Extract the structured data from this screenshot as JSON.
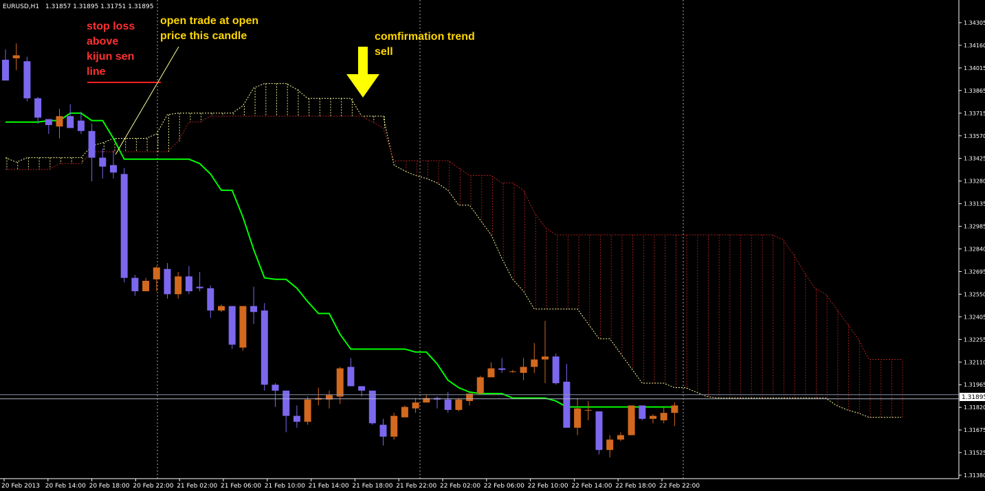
{
  "header": {
    "symbol": "EURUSD,H1",
    "ohlc": "1.31857 1.31895 1.31751 1.31895"
  },
  "colors": {
    "background": "#000000",
    "bull_candle": "#d2691e",
    "bear_candle": "#7b68ee",
    "kijun_sen": "#00ff00",
    "senkou_span_a": "#ffff99",
    "senkou_span_b": "#b22222",
    "axis": "#ffffff",
    "arrow": "#ffff00",
    "stop_loss_text": "#ff3030",
    "trade_text": "#ffd700"
  },
  "annotations": {
    "stop_loss": [
      "stop loss",
      "above",
      "kijun sen",
      "line"
    ],
    "open_trade": [
      "open trade at open",
      "price this candle"
    ],
    "confirmation": [
      "comfirmation trend",
      "sell"
    ]
  },
  "chart_data": {
    "type": "candlestick",
    "title": "EURUSD,H1",
    "ylim": [
      1.3138,
      1.3443
    ],
    "y_ticks": [
      "1.34305",
      "1.34160",
      "1.34015",
      "1.33865",
      "1.33715",
      "1.33570",
      "1.33425",
      "1.33280",
      "1.33135",
      "1.32985",
      "1.32840",
      "1.32695",
      "1.32550",
      "1.32405",
      "1.32255",
      "1.32110",
      "1.31965",
      "1.31820",
      "1.31675",
      "1.31525",
      "1.31380"
    ],
    "current_price": "1.31895",
    "x_labels": [
      "20 Feb 2013",
      "20 Feb 14:00",
      "20 Feb 18:00",
      "20 Feb 22:00",
      "21 Feb 02:00",
      "21 Feb 06:00",
      "21 Feb 10:00",
      "21 Feb 14:00",
      "21 Feb 18:00",
      "21 Feb 22:00",
      "22 Feb 02:00",
      "22 Feb 06:00",
      "22 Feb 10:00",
      "22 Feb 14:00",
      "22 Feb 18:00",
      "22 Feb 22:00"
    ],
    "candles": [
      {
        "o": 1.3418,
        "h": 1.3425,
        "l": 1.3404,
        "c": 1.3404
      },
      {
        "o": 1.3419,
        "h": 1.3429,
        "l": 1.3411,
        "c": 1.3421
      },
      {
        "o": 1.3417,
        "h": 1.342,
        "l": 1.339,
        "c": 1.3392
      },
      {
        "o": 1.3392,
        "h": 1.3393,
        "l": 1.3375,
        "c": 1.3379
      },
      {
        "o": 1.3378,
        "h": 1.3378,
        "l": 1.3368,
        "c": 1.3374
      },
      {
        "o": 1.3373,
        "h": 1.3385,
        "l": 1.3365,
        "c": 1.338
      },
      {
        "o": 1.338,
        "h": 1.3388,
        "l": 1.3373,
        "c": 1.3372
      },
      {
        "o": 1.3377,
        "h": 1.3383,
        "l": 1.3368,
        "c": 1.337
      },
      {
        "o": 1.337,
        "h": 1.3375,
        "l": 1.3336,
        "c": 1.3352
      },
      {
        "o": 1.3352,
        "h": 1.3358,
        "l": 1.3338,
        "c": 1.3346
      },
      {
        "o": 1.3347,
        "h": 1.3357,
        "l": 1.3338,
        "c": 1.3342
      },
      {
        "o": 1.3341,
        "h": 1.3345,
        "l": 1.3268,
        "c": 1.3271
      },
      {
        "o": 1.3271,
        "h": 1.3273,
        "l": 1.3259,
        "c": 1.3262
      },
      {
        "o": 1.3262,
        "h": 1.3271,
        "l": 1.3262,
        "c": 1.3269
      },
      {
        "o": 1.327,
        "h": 1.3279,
        "l": 1.3262,
        "c": 1.3278
      },
      {
        "o": 1.3277,
        "h": 1.3281,
        "l": 1.3257,
        "c": 1.326
      },
      {
        "o": 1.326,
        "h": 1.3275,
        "l": 1.3257,
        "c": 1.3272
      },
      {
        "o": 1.3272,
        "h": 1.3279,
        "l": 1.326,
        "c": 1.3262
      },
      {
        "o": 1.3265,
        "h": 1.3275,
        "l": 1.3262,
        "c": 1.3264
      },
      {
        "o": 1.3264,
        "h": 1.3266,
        "l": 1.3244,
        "c": 1.3249
      },
      {
        "o": 1.3249,
        "h": 1.3253,
        "l": 1.3248,
        "c": 1.3252
      },
      {
        "o": 1.3252,
        "h": 1.3252,
        "l": 1.3223,
        "c": 1.3226
      },
      {
        "o": 1.3224,
        "h": 1.3252,
        "l": 1.3222,
        "c": 1.3252
      },
      {
        "o": 1.3252,
        "h": 1.3265,
        "l": 1.324,
        "c": 1.3248
      },
      {
        "o": 1.3249,
        "h": 1.3254,
        "l": 1.3195,
        "c": 1.3199
      },
      {
        "o": 1.3199,
        "h": 1.32,
        "l": 1.3184,
        "c": 1.3195
      },
      {
        "o": 1.3195,
        "h": 1.3195,
        "l": 1.3167,
        "c": 1.3178
      },
      {
        "o": 1.3178,
        "h": 1.3185,
        "l": 1.317,
        "c": 1.3174
      },
      {
        "o": 1.3174,
        "h": 1.3191,
        "l": 1.3172,
        "c": 1.3189
      },
      {
        "o": 1.3189,
        "h": 1.3197,
        "l": 1.3185,
        "c": 1.319
      },
      {
        "o": 1.3189,
        "h": 1.3195,
        "l": 1.3183,
        "c": 1.3192
      },
      {
        "o": 1.3191,
        "h": 1.3211,
        "l": 1.3186,
        "c": 1.321
      },
      {
        "o": 1.3211,
        "h": 1.3217,
        "l": 1.3198,
        "c": 1.3198
      },
      {
        "o": 1.3198,
        "h": 1.3198,
        "l": 1.3191,
        "c": 1.3195
      },
      {
        "o": 1.3195,
        "h": 1.3195,
        "l": 1.3172,
        "c": 1.3173
      },
      {
        "o": 1.3172,
        "h": 1.3176,
        "l": 1.3158,
        "c": 1.3164
      },
      {
        "o": 1.3164,
        "h": 1.318,
        "l": 1.3162,
        "c": 1.3178
      },
      {
        "o": 1.3177,
        "h": 1.3185,
        "l": 1.3177,
        "c": 1.3184
      },
      {
        "o": 1.3183,
        "h": 1.319,
        "l": 1.318,
        "c": 1.3187
      },
      {
        "o": 1.3187,
        "h": 1.3192,
        "l": 1.3187,
        "c": 1.319
      },
      {
        "o": 1.319,
        "h": 1.3191,
        "l": 1.3183,
        "c": 1.3189
      },
      {
        "o": 1.3189,
        "h": 1.3194,
        "l": 1.318,
        "c": 1.3182
      },
      {
        "o": 1.3182,
        "h": 1.319,
        "l": 1.3181,
        "c": 1.3189
      },
      {
        "o": 1.3188,
        "h": 1.3193,
        "l": 1.3185,
        "c": 1.3193
      },
      {
        "o": 1.3193,
        "h": 1.3205,
        "l": 1.3193,
        "c": 1.3204
      },
      {
        "o": 1.3204,
        "h": 1.3214,
        "l": 1.3204,
        "c": 1.321
      },
      {
        "o": 1.321,
        "h": 1.3217,
        "l": 1.3207,
        "c": 1.3209
      },
      {
        "o": 1.3208,
        "h": 1.3209,
        "l": 1.3207,
        "c": 1.3208
      },
      {
        "o": 1.3207,
        "h": 1.3217,
        "l": 1.3202,
        "c": 1.3211
      },
      {
        "o": 1.3211,
        "h": 1.3227,
        "l": 1.3207,
        "c": 1.3216
      },
      {
        "o": 1.3216,
        "h": 1.3242,
        "l": 1.32,
        "c": 1.3218
      },
      {
        "o": 1.3218,
        "h": 1.322,
        "l": 1.3199,
        "c": 1.32
      },
      {
        "o": 1.3201,
        "h": 1.3213,
        "l": 1.317,
        "c": 1.317
      },
      {
        "o": 1.317,
        "h": 1.319,
        "l": 1.3165,
        "c": 1.3183
      },
      {
        "o": 1.3182,
        "h": 1.3188,
        "l": 1.3175,
        "c": 1.3182
      },
      {
        "o": 1.3181,
        "h": 1.3181,
        "l": 1.3152,
        "c": 1.3155
      },
      {
        "o": 1.3155,
        "h": 1.3165,
        "l": 1.315,
        "c": 1.3162
      },
      {
        "o": 1.3162,
        "h": 1.3167,
        "l": 1.3161,
        "c": 1.3165
      },
      {
        "o": 1.3165,
        "h": 1.3185,
        "l": 1.3165,
        "c": 1.3185
      },
      {
        "o": 1.3185,
        "h": 1.3185,
        "l": 1.3175,
        "c": 1.3176
      },
      {
        "o": 1.3176,
        "h": 1.3179,
        "l": 1.3173,
        "c": 1.3178
      },
      {
        "o": 1.3175,
        "h": 1.3184,
        "l": 1.3173,
        "c": 1.318
      },
      {
        "o": 1.318,
        "h": 1.3187,
        "l": 1.3171,
        "c": 1.3185
      }
    ],
    "kijun_sen": [
      1.3376,
      1.3376,
      1.3376,
      1.3376,
      1.3377,
      1.3377,
      1.3382,
      1.3382,
      1.3377,
      1.3377,
      1.3365,
      1.3351,
      1.3351,
      1.3351,
      1.3351,
      1.3351,
      1.3351,
      1.3351,
      1.3348,
      1.3341,
      1.333,
      1.333,
      1.3312,
      1.329,
      1.3271,
      1.327,
      1.327,
      1.3264,
      1.3255,
      1.3247,
      1.3247,
      1.3233,
      1.3223,
      1.3223,
      1.3223,
      1.3223,
      1.3223,
      1.3223,
      1.3221,
      1.3221,
      1.3213,
      1.3202,
      1.3197,
      1.3194,
      1.3193,
      1.3193,
      1.3193,
      1.319,
      1.319,
      1.319,
      1.319,
      1.3188,
      1.3184,
      1.3184,
      1.3184,
      1.3184,
      1.3184,
      1.3184,
      1.3184,
      1.3184,
      1.3184,
      1.3184,
      1.3184
    ],
    "senkou_span_a": [
      1.3352,
      1.3349,
      1.3352,
      1.3352,
      1.3352,
      1.3352,
      1.3352,
      1.3352,
      1.336,
      1.3362,
      1.3365,
      1.3365,
      1.3365,
      1.3365,
      1.3368,
      1.3381,
      1.3382,
      1.3382,
      1.3382,
      1.3382,
      1.3382,
      1.3382,
      1.3387,
      1.3399,
      1.3402,
      1.3402,
      1.3402,
      1.3398,
      1.3392,
      1.3392,
      1.3392,
      1.3392,
      1.3392,
      1.338,
      1.338,
      1.338,
      1.3347,
      1.3343,
      1.334,
      1.3338,
      1.3335,
      1.333,
      1.332,
      1.332,
      1.331,
      1.33,
      1.3284,
      1.327,
      1.3262,
      1.325,
      1.325,
      1.325,
      1.325,
      1.325,
      1.324,
      1.323,
      1.323,
      1.322,
      1.321,
      1.32,
      1.32,
      1.32,
      1.3197,
      1.3197,
      1.3194,
      1.3191,
      1.319,
      1.319,
      1.319,
      1.319,
      1.319,
      1.319,
      1.319,
      1.319,
      1.319,
      1.319,
      1.319,
      1.3185,
      1.3182,
      1.318,
      1.3177,
      1.3177,
      1.3177,
      1.3177
    ],
    "senkou_span_b": [
      1.3344,
      1.3344,
      1.3344,
      1.3344,
      1.3344,
      1.3348,
      1.3348,
      1.3348,
      1.3356,
      1.3356,
      1.3356,
      1.3356,
      1.3356,
      1.3356,
      1.3356,
      1.3356,
      1.3363,
      1.3376,
      1.3376,
      1.338,
      1.338,
      1.338,
      1.338,
      1.338,
      1.338,
      1.338,
      1.338,
      1.338,
      1.338,
      1.338,
      1.338,
      1.338,
      1.338,
      1.338,
      1.3376,
      1.3372,
      1.335,
      1.335,
      1.335,
      1.335,
      1.335,
      1.335,
      1.3345,
      1.334,
      1.334,
      1.334,
      1.3335,
      1.3335,
      1.333,
      1.3315,
      1.3305,
      1.33,
      1.33,
      1.33,
      1.33,
      1.33,
      1.33,
      1.33,
      1.33,
      1.33,
      1.33,
      1.33,
      1.33,
      1.33,
      1.33,
      1.33,
      1.33,
      1.33,
      1.33,
      1.33,
      1.33,
      1.33,
      1.3297,
      1.3287,
      1.3275,
      1.3264,
      1.326,
      1.325,
      1.324,
      1.323,
      1.3216,
      1.3216,
      1.3216,
      1.3216
    ]
  }
}
